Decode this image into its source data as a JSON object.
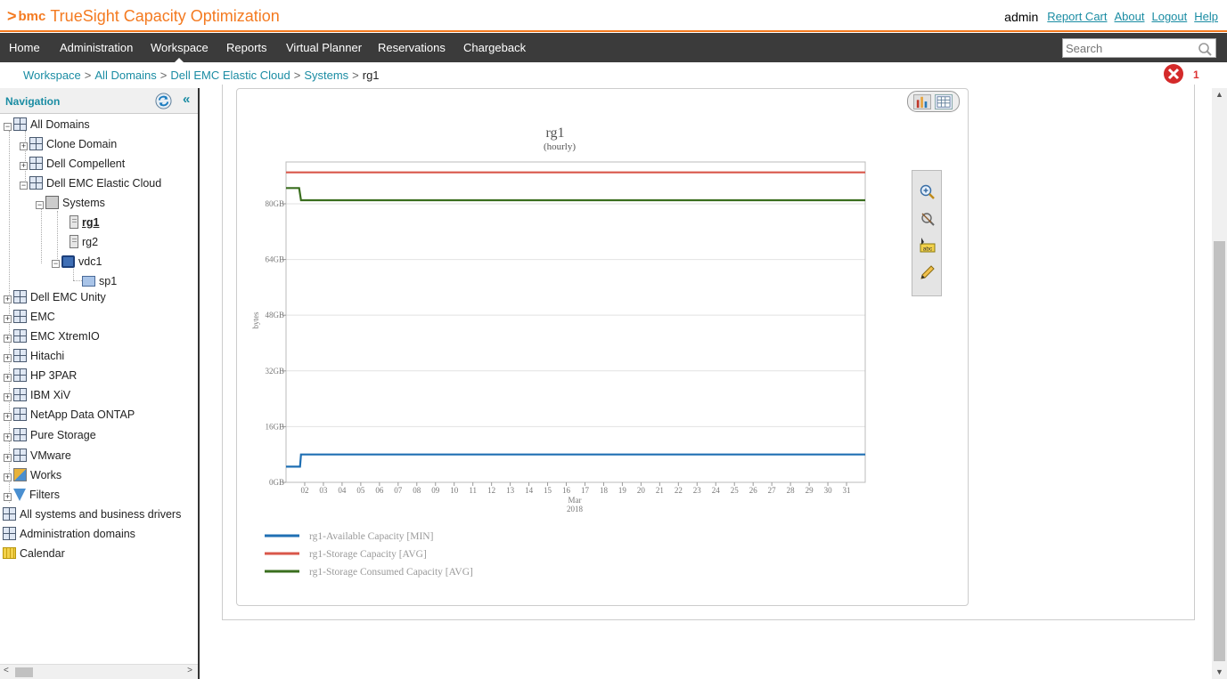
{
  "header": {
    "brand": "bmc",
    "app_title": "TrueSight Capacity Optimization",
    "user": "admin",
    "links": [
      "Report Cart",
      "About",
      "Logout",
      "Help"
    ]
  },
  "menu": {
    "items": [
      "Home",
      "Administration",
      "Workspace",
      "Reports",
      "Virtual Planner",
      "Reservations",
      "Chargeback"
    ],
    "active": "Workspace",
    "search_placeholder": "Search"
  },
  "breadcrumb": {
    "items": [
      "Workspace",
      "All Domains",
      "Dell EMC Elastic Cloud",
      "Systems"
    ],
    "current": "rg1",
    "separator": ">"
  },
  "errors": {
    "count": "1"
  },
  "navigation": {
    "title": "Navigation",
    "collapse_glyph": "«",
    "tree": [
      {
        "label": "All Domains",
        "icon": "domain-icon",
        "expanded": true
      },
      {
        "label": "Clone Domain",
        "icon": "domain-icon"
      },
      {
        "label": "Dell Compellent",
        "icon": "domain-icon"
      },
      {
        "label": "Dell EMC Elastic Cloud",
        "icon": "domain-icon",
        "expanded": true
      },
      {
        "label": "Systems",
        "icon": "systems-folder-icon",
        "expanded": true
      },
      {
        "label": "rg1",
        "icon": "server-icon",
        "selected": true
      },
      {
        "label": "rg2",
        "icon": "server-icon"
      },
      {
        "label": "vdc1",
        "icon": "vdc-icon",
        "expanded": true
      },
      {
        "label": "sp1",
        "icon": "storage-pool-icon"
      },
      {
        "label": "Dell EMC Unity",
        "icon": "domain-icon"
      },
      {
        "label": "EMC",
        "icon": "domain-icon"
      },
      {
        "label": "EMC XtremIO",
        "icon": "domain-icon"
      },
      {
        "label": "Hitachi",
        "icon": "domain-icon"
      },
      {
        "label": "HP 3PAR",
        "icon": "domain-icon"
      },
      {
        "label": "IBM XiV",
        "icon": "domain-icon"
      },
      {
        "label": "NetApp Data ONTAP",
        "icon": "domain-icon"
      },
      {
        "label": "Pure Storage",
        "icon": "domain-icon"
      },
      {
        "label": "VMware",
        "icon": "domain-icon"
      },
      {
        "label": "Works",
        "icon": "works-icon"
      },
      {
        "label": "Filters",
        "icon": "filter-icon"
      },
      {
        "label": "All systems and business drivers",
        "icon": "domain-icon"
      },
      {
        "label": "Administration domains",
        "icon": "domain-icon"
      },
      {
        "label": "Calendar",
        "icon": "calendar-icon"
      }
    ]
  },
  "chart_data": {
    "type": "line",
    "title": "rg1",
    "subtitle": "(hourly)",
    "ylabel": "bytes",
    "xlabel": "Mar\n2018",
    "x_month": "Mar",
    "x_year": "2018",
    "x_ticks": [
      "02",
      "03",
      "04",
      "05",
      "06",
      "07",
      "08",
      "09",
      "10",
      "11",
      "12",
      "13",
      "14",
      "15",
      "16",
      "17",
      "18",
      "19",
      "20",
      "21",
      "22",
      "23",
      "24",
      "25",
      "26",
      "27",
      "28",
      "29",
      "30",
      "31"
    ],
    "y_ticks": [
      "0GB",
      "16GB",
      "32GB",
      "48GB",
      "64GB",
      "80GB"
    ],
    "y_unit": "GB",
    "ylim": [
      0,
      92
    ],
    "xlim": [
      1,
      32
    ],
    "grid": true,
    "legend_position": "bottom-left",
    "series": [
      {
        "name": "rg1-Available Capacity [MIN]",
        "color": "#1f6fb3",
        "points": [
          [
            1,
            4.5
          ],
          [
            1.75,
            4.5
          ],
          [
            1.8,
            8
          ],
          [
            32,
            8
          ]
        ]
      },
      {
        "name": "rg1-Storage Capacity [AVG]",
        "color": "#d9574a",
        "points": [
          [
            1,
            89
          ],
          [
            32,
            89
          ]
        ]
      },
      {
        "name": "rg1-Storage Consumed Capacity [AVG]",
        "color": "#3a6e1e",
        "points": [
          [
            1,
            84.5
          ],
          [
            1.7,
            84.5
          ],
          [
            1.8,
            81
          ],
          [
            32,
            81
          ]
        ]
      }
    ]
  },
  "icons": {
    "zoom": "zoom-in-icon",
    "pan": "pan-icon",
    "label": "label-abc-icon",
    "edit": "pencil-icon",
    "chart_view": "bar-chart-icon",
    "table_view": "table-icon"
  }
}
